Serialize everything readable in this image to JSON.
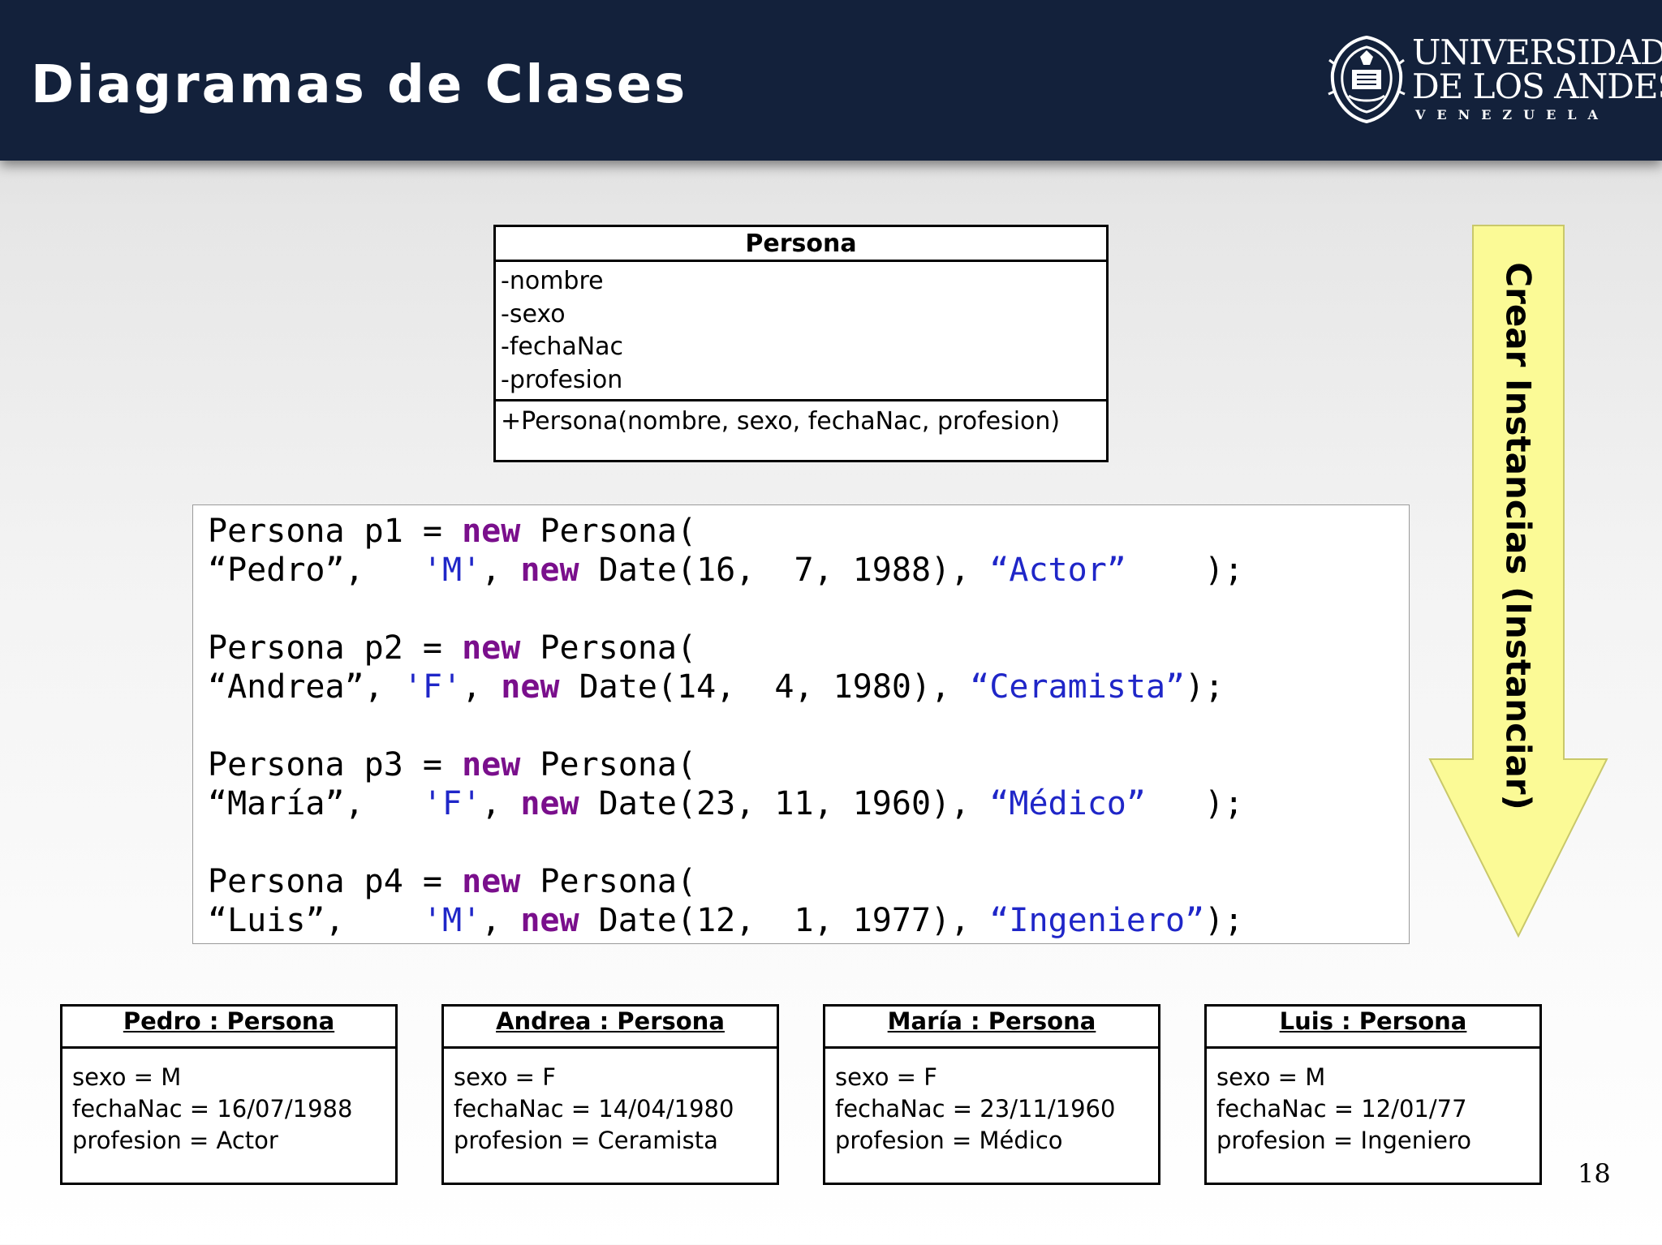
{
  "header": {
    "title": "Diagramas de Clases",
    "logo": {
      "line1": "UNIVERSIDAD",
      "line2": "DE LOS ANDES",
      "line3": "VENEZUELA",
      "icon": "university-seal-icon"
    }
  },
  "class_diagram": {
    "name": "Persona",
    "attributes": [
      "-nombre",
      "-sexo",
      "-fechaNac",
      "-profesion"
    ],
    "operations": [
      "+Persona(nombre, sexo, fechaNac, profesion)"
    ]
  },
  "code": {
    "colors": {
      "keyword": "#7a0f8c",
      "string": "#1f26c8"
    },
    "lines": [
      [
        [
          "t",
          "Persona p1 = "
        ],
        [
          "k",
          "new"
        ],
        [
          "t",
          " Persona("
        ]
      ],
      [
        [
          "t",
          "“Pedro”,   "
        ],
        [
          "s",
          "'M'"
        ],
        [
          "t",
          ", "
        ],
        [
          "k",
          "new"
        ],
        [
          "t",
          " Date(16,  7, 1988), "
        ],
        [
          "s",
          "“Actor”"
        ],
        [
          "t",
          "    );"
        ]
      ],
      [],
      [
        [
          "t",
          "Persona p2 = "
        ],
        [
          "k",
          "new"
        ],
        [
          "t",
          " Persona("
        ]
      ],
      [
        [
          "t",
          "“Andrea”, "
        ],
        [
          "s",
          "'F'"
        ],
        [
          "t",
          ", "
        ],
        [
          "k",
          "new"
        ],
        [
          "t",
          " Date(14,  4, 1980), "
        ],
        [
          "s",
          "“Ceramista”"
        ],
        [
          "t",
          ");"
        ]
      ],
      [],
      [
        [
          "t",
          "Persona p3 = "
        ],
        [
          "k",
          "new"
        ],
        [
          "t",
          " Persona("
        ]
      ],
      [
        [
          "t",
          "“María”,   "
        ],
        [
          "s",
          "'F'"
        ],
        [
          "t",
          ", "
        ],
        [
          "k",
          "new"
        ],
        [
          "t",
          " Date(23, 11, 1960), "
        ],
        [
          "s",
          "“Médico”"
        ],
        [
          "t",
          "   );"
        ]
      ],
      [],
      [
        [
          "t",
          "Persona p4 = "
        ],
        [
          "k",
          "new"
        ],
        [
          "t",
          " Persona("
        ]
      ],
      [
        [
          "t",
          "“Luis”,    "
        ],
        [
          "s",
          "'M'"
        ],
        [
          "t",
          ", "
        ],
        [
          "k",
          "new"
        ],
        [
          "t",
          " Date(12,  1, 1977), "
        ],
        [
          "s",
          "“Ingeniero”"
        ],
        [
          "t",
          ");"
        ]
      ]
    ]
  },
  "arrow": {
    "label": "Crear Instancias (Instanciar)",
    "fill": "#fbfa96",
    "stroke": "#c9c86a"
  },
  "instances": [
    {
      "title": "Pedro : Persona",
      "fields": [
        "sexo = M",
        "fechaNac = 16/07/1988",
        "profesion = Actor"
      ]
    },
    {
      "title": "Andrea : Persona",
      "fields": [
        "sexo = F",
        "fechaNac = 14/04/1980",
        "profesion = Ceramista"
      ]
    },
    {
      "title": "María : Persona",
      "fields": [
        "sexo = F",
        "fechaNac = 23/11/1960",
        "profesion = Médico"
      ]
    },
    {
      "title": "Luis : Persona",
      "fields": [
        "sexo = M",
        "fechaNac = 12/01/77",
        "profesion = Ingeniero"
      ]
    }
  ],
  "page_number": "18"
}
